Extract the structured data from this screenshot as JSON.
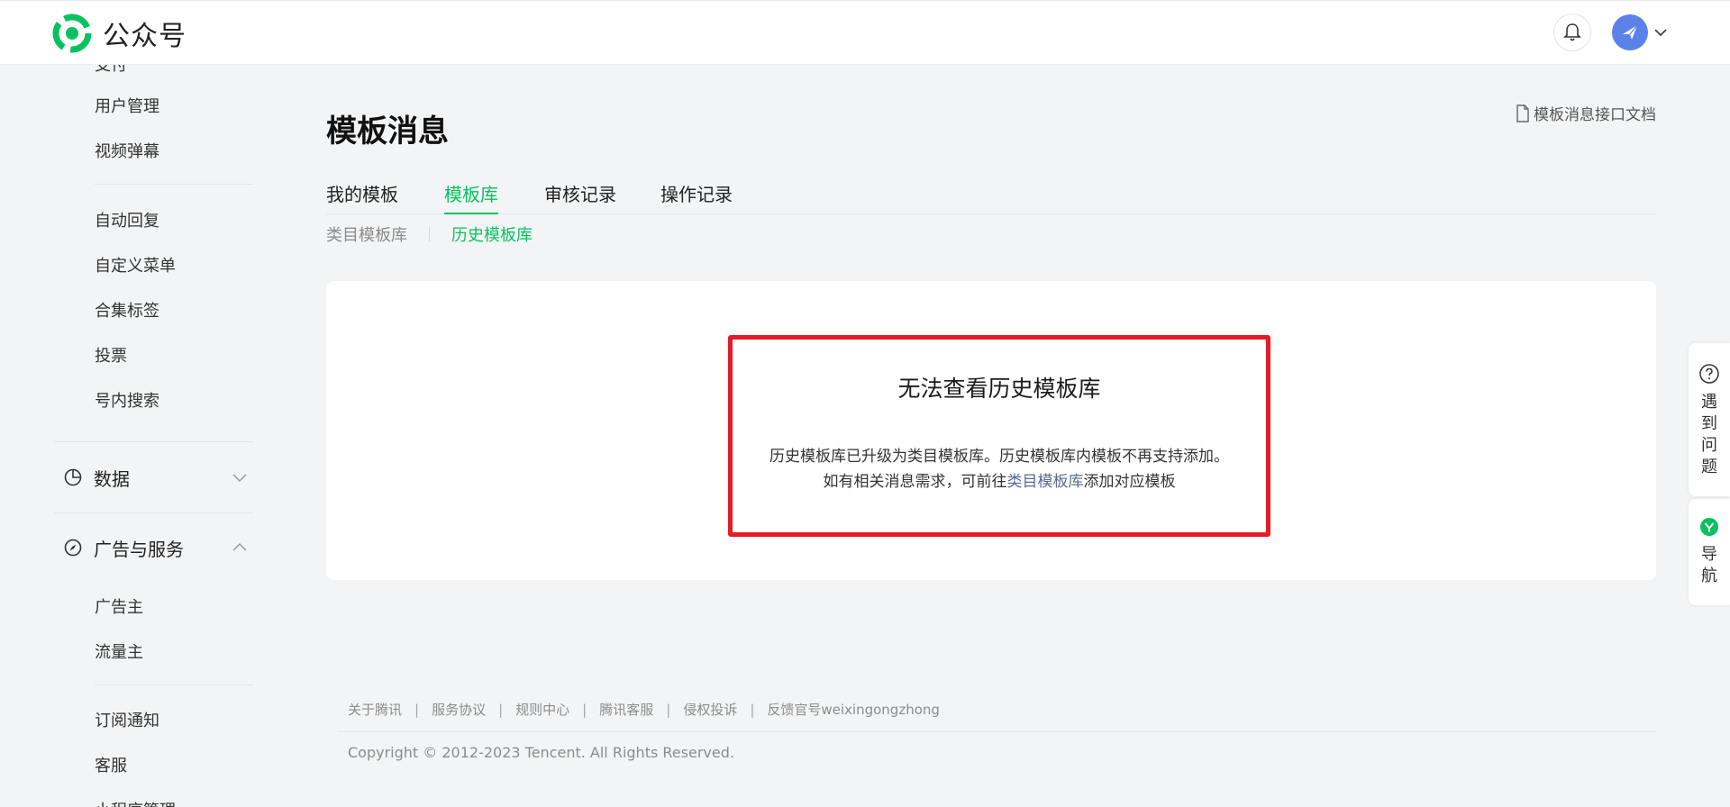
{
  "header": {
    "logo_text": "公众号",
    "notification_icon": "bell-icon",
    "avatar_icon": "paper-plane-icon",
    "accent_color": "#07c160"
  },
  "sidebar": {
    "clipped_top_item": "支付",
    "items_top": [
      {
        "label": "用户管理"
      },
      {
        "label": "视频弹幕"
      }
    ],
    "items_mid": [
      {
        "label": "自动回复"
      },
      {
        "label": "自定义菜单"
      },
      {
        "label": "合集标签"
      },
      {
        "label": "投票"
      },
      {
        "label": "号内搜索"
      }
    ],
    "group_data": {
      "label": "数据",
      "icon": "pie-chart-icon",
      "expanded": false
    },
    "group_ads": {
      "label": "广告与服务",
      "icon": "compass-icon",
      "expanded": true
    },
    "items_ads": [
      {
        "label": "广告主"
      },
      {
        "label": "流量主"
      }
    ],
    "items_bottom": [
      {
        "label": "订阅通知"
      },
      {
        "label": "客服"
      },
      {
        "label": "小程序管理"
      }
    ]
  },
  "main": {
    "title": "模板消息",
    "doc_link": "模板消息接口文档",
    "tabs": [
      {
        "label": "我的模板",
        "active": false
      },
      {
        "label": "模板库",
        "active": true
      },
      {
        "label": "审核记录",
        "active": false
      },
      {
        "label": "操作记录",
        "active": false
      }
    ],
    "subtabs": [
      {
        "label": "类目模板库",
        "active": false
      },
      {
        "label": "历史模板库",
        "active": true
      }
    ],
    "notice": {
      "title": "无法查看历史模板库",
      "line1": "历史模板库已升级为类目模板库。历史模板库内模板不再支持添加。",
      "line2_prefix": "如有相关消息需求，可前往",
      "line2_link": "类目模板库",
      "line2_suffix": "添加对应模板",
      "border_color": "#e31c26"
    }
  },
  "footer": {
    "links": [
      "关于腾讯",
      "服务协议",
      "规则中心",
      "腾讯客服",
      "侵权投诉",
      "反馈官号weixingongzhong"
    ],
    "copyright": "Copyright © 2012-2023 Tencent. All Rights Reserved."
  },
  "float": {
    "help_label": "遇到问题",
    "help_icon": "question-circle-icon",
    "nav_label": "导航",
    "nav_icon": "green-badge-icon"
  }
}
